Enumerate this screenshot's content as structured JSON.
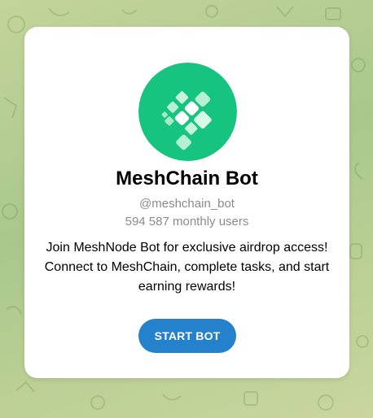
{
  "bot": {
    "name": "MeshChain Bot",
    "username": "@meshchain_bot",
    "monthly_users": "594 587 monthly users",
    "description_lines": [
      "Join MeshNode Bot for exclusive airdrop access!",
      "Connect to MeshChain, complete tasks, and start",
      "earning rewards!"
    ],
    "start_label": "START BOT",
    "avatar_icon": "meshchain-logo-icon"
  },
  "colors": {
    "avatar_bg": "#16c47f",
    "button_bg": "#2481cc",
    "muted_text": "#8b8b8b"
  }
}
